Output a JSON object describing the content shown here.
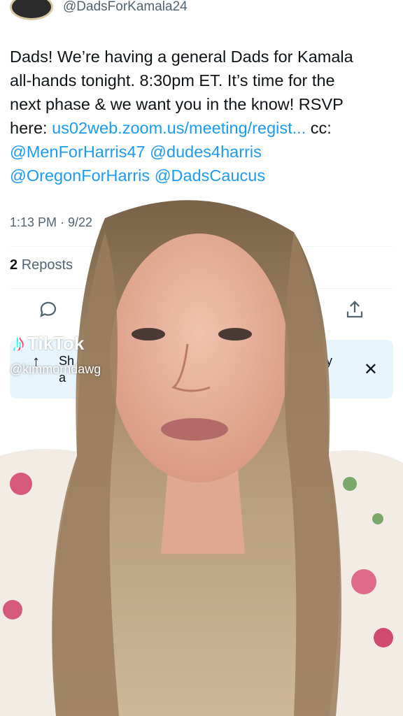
{
  "tweet": {
    "handle": "@DadsForKamala24",
    "text_line1": "Dads! We’re having a general Dads for Kamala",
    "text_line2": "all-hands tonight. 8:30pm ET. It’s time for the",
    "text_line3": "next phase & we want you in the know! RSVP",
    "text_line4_prefix": "here: ",
    "link": "us02web.zoom.us/meeting/regist...",
    "text_line4_suffix": " cc:",
    "mentions_line5": [
      "@MenForHarris47",
      "@dudes4harris"
    ],
    "mentions_line6": [
      "@OregonForHarris",
      "@DadsCaucus"
    ],
    "timestamp": "1:13 PM · 9/22",
    "reposts_count": "2",
    "reposts_label": "Reposts"
  },
  "share_bar": {
    "text_partial_1": "Sh",
    "text_partial_2": "a",
    "text_partial_3": "y",
    "close_label": "✕",
    "upload_label": "↑"
  },
  "overlay": {
    "brand": "TikTok",
    "username": "@kimmorndawg"
  },
  "icons": {
    "reply": "reply-icon",
    "share": "share-icon",
    "tiktok": "tiktok-logo-icon"
  },
  "colors": {
    "link": "#1d9bf0",
    "text": "#0f1419",
    "muted": "#536471",
    "share_bar_bg": "#e8f5fd"
  }
}
